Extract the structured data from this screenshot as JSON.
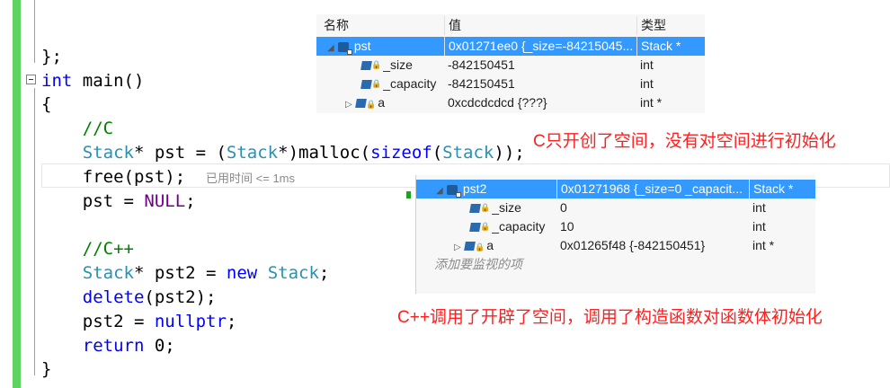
{
  "code": {
    "close_brace_semicolon": "};",
    "main_sig_kw": "int",
    "main_sig_rest": " main()",
    "open_brace": "{",
    "comment_c": "//C",
    "l4_type": "Stack",
    "l4_a": "* pst = (",
    "l4_type2": "Stack",
    "l4_b": "*)malloc(",
    "l4_kw": "sizeof",
    "l4_c": "(",
    "l4_type3": "Stack",
    "l4_d": "));",
    "l5_code": "free(pst);",
    "l5_hint": "已用时间 <= 1ms",
    "l6_a": "pst = ",
    "l6_macro": "NULL",
    "l6_b": ";",
    "comment_cpp": "//C++",
    "l8_type": "Stack",
    "l8_a": "* pst2 = ",
    "l8_kw": "new",
    "l8_b": " ",
    "l8_type2": "Stack",
    "l8_c": ";",
    "l9_kw": "delete",
    "l9_a": "(pst2);",
    "l10_a": "pst2 = ",
    "l10_kw": "nullptr",
    "l10_b": ";",
    "l11_kw": "return",
    "l11_a": " 0;",
    "close_brace": "}"
  },
  "watch1": {
    "headers": {
      "name": "名称",
      "value": "值",
      "type": "类型"
    },
    "rows": [
      {
        "name": "pst",
        "value": "0x01271ee0 {_size=-84215045...",
        "type": "Stack *"
      },
      {
        "name": "_size",
        "value": "-842150451",
        "type": "int"
      },
      {
        "name": "_capacity",
        "value": "-842150451",
        "type": "int"
      },
      {
        "name": "a",
        "value": "0xcdcdcdcd {???}",
        "type": "int *"
      }
    ]
  },
  "watch2": {
    "rows": [
      {
        "name": "pst2",
        "value": "0x01271968 {_size=0 _capacit...",
        "type": "Stack *"
      },
      {
        "name": "_size",
        "value": "0",
        "type": "int"
      },
      {
        "name": "_capacity",
        "value": "10",
        "type": "int"
      },
      {
        "name": "a",
        "value": "0x01265f48 {-842150451}",
        "type": "int *"
      }
    ],
    "add_watch": "添加要监视的项"
  },
  "annotations": {
    "c_note": "C只开创了空间，没有对空间进行初始化",
    "cpp_note": "C++调用了开辟了空间，调用了构造函数对函数体初始化"
  },
  "colors": {
    "selection": "#3399ff",
    "annotation": "#ff2020",
    "change_bar": "#5fd35f"
  }
}
